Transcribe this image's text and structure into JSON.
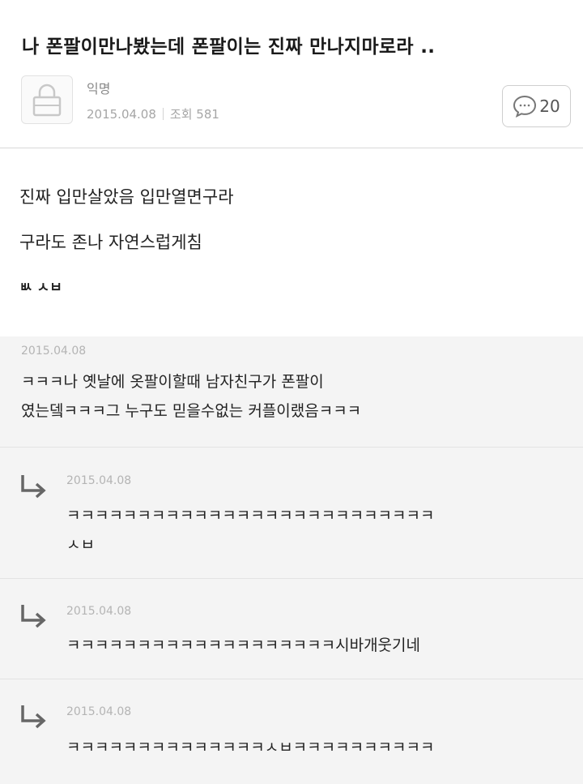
{
  "post": {
    "title": "나 폰팔이만나봤는데 폰팔이는 진짜 만나지마로라 ..",
    "author": "익명",
    "date": "2015.04.08",
    "views_label": "조회",
    "views_count": "581",
    "comment_count": "20",
    "body_lines": [
      "진짜 입만살았음 입만열면구라",
      "구라도 존나 자연스럽게침",
      "ㅄ ㅅㅂ"
    ]
  },
  "comments": [
    {
      "date": "2015.04.08",
      "lines": [
        "ㅋㅋㅋ나 옛날에 옷팔이할때 남자친구가 폰팔이",
        "였는뎈ㅋㅋㅋ그 누구도 믿을수없는 커플이랬음ㅋㅋㅋ"
      ]
    },
    {
      "date": "2015.04.08",
      "lines": [
        "ㅋㅋㅋㅋㅋㅋㅋㅋㅋㅋㅋㅋㅋㅋㅋㅋㅋㅋㅋㅋㅋㅋㅋㅋㅋㅋ",
        "ㅅㅂ"
      ]
    },
    {
      "date": "2015.04.08",
      "lines": [
        "ㅋㅋㅋㅋㅋㅋㅋㅋㅋㅋㅋㅋㅋㅋㅋㅋㅋㅋㅋ시바개웃기네"
      ]
    },
    {
      "date": "2015.04.08",
      "lines": [
        "ㅋㅋㅋㅋㅋㅋㅋㅋㅋㅋㅋㅋㅋㅋㅅㅂㅋㅋㅋㅋㅋㅋㅋㅋㅋㅋ"
      ]
    }
  ],
  "icons": {
    "avatar": "lock-icon",
    "comment": "speech-bubble-icon",
    "reply": "reply-arrow-icon"
  },
  "colors": {
    "comment_bg": "#f4f4f4",
    "meta_text": "#a6a6a6"
  }
}
